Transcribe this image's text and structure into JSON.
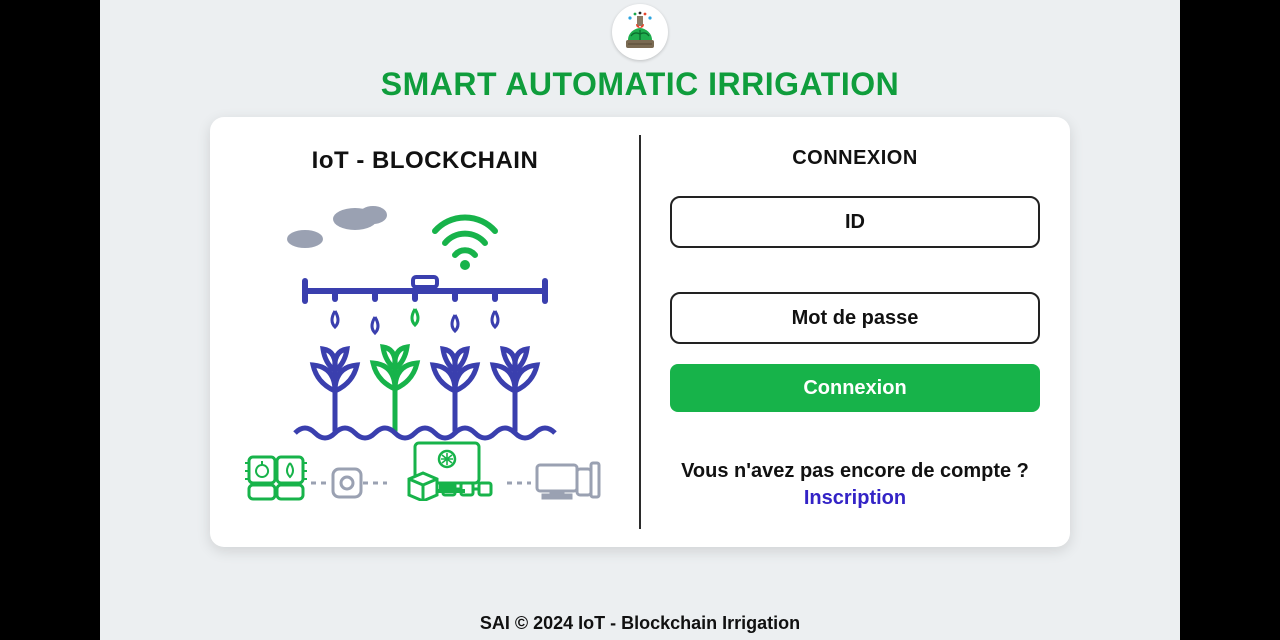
{
  "app": {
    "title": "SMART AUTOMATIC IRRIGATION"
  },
  "left": {
    "title": "IoT - BLOCKCHAIN"
  },
  "login": {
    "heading": "CONNEXION",
    "id_placeholder": "ID",
    "password_placeholder": "Mot de passe",
    "submit_label": "Connexion",
    "signup_question": "Vous n'avez pas encore de compte ?",
    "signup_link_label": "Inscription"
  },
  "footer": {
    "text": "SAI © 2024 IoT - Blockchain Irrigation"
  },
  "colors": {
    "accent": "#17b34a",
    "title_green": "#0f9d3c",
    "link": "#3323c6"
  }
}
